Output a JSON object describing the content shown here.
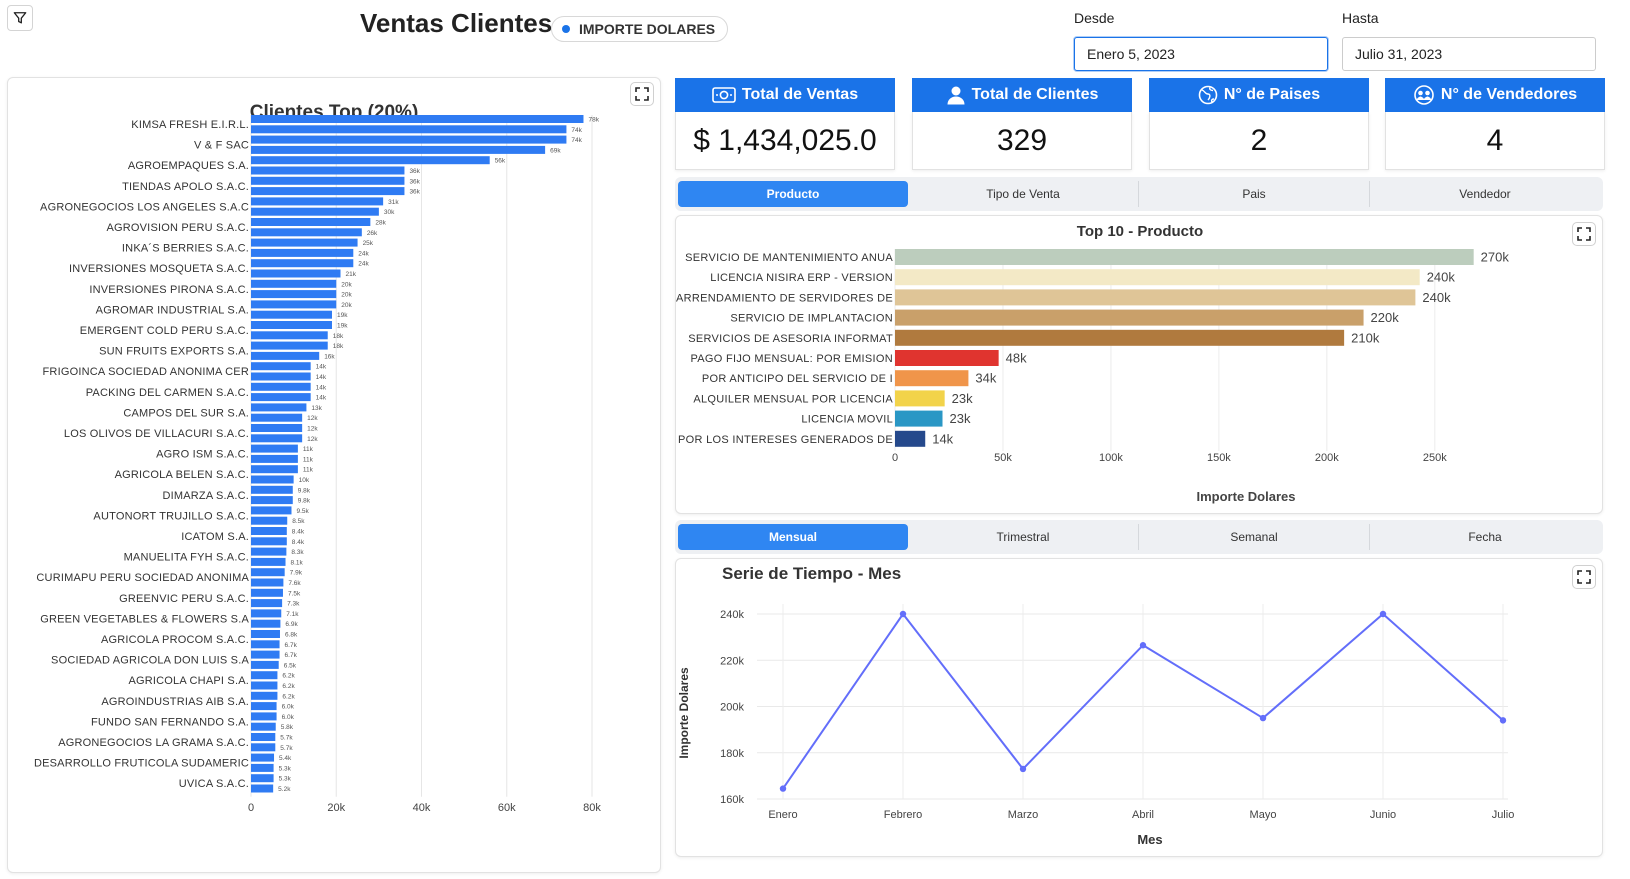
{
  "header": {
    "title": "Ventas Clientes",
    "metric_pill": "IMPORTE DOLARES",
    "desde_label": "Desde",
    "desde_value": "Enero 5, 2023",
    "hasta_label": "Hasta",
    "hasta_value": "Julio 31, 2023"
  },
  "kpis": [
    {
      "label": "Total de Ventas",
      "value": "$ 1,434,025.0",
      "icon": "money-icon"
    },
    {
      "label": "Total de Clientes",
      "value": "329",
      "icon": "user-icon"
    },
    {
      "label": "N° de Paises",
      "value": "2",
      "icon": "globe-icon"
    },
    {
      "label": "N° de Vendedores",
      "value": "4",
      "icon": "team-icon"
    }
  ],
  "tabs_top": [
    {
      "label": "Producto",
      "active": true
    },
    {
      "label": "Tipo de Venta",
      "active": false
    },
    {
      "label": "Pais",
      "active": false
    },
    {
      "label": "Vendedor",
      "active": false
    }
  ],
  "tabs_time": [
    {
      "label": "Mensual",
      "active": true
    },
    {
      "label": "Trimestral",
      "active": false
    },
    {
      "label": "Semanal",
      "active": false
    },
    {
      "label": "Fecha",
      "active": false
    }
  ],
  "colors": {
    "accent": "#1a73e8",
    "bar_blue": "#2f7bf3",
    "line": "#636efa"
  },
  "chart_data": [
    {
      "type": "bar",
      "orientation": "horizontal",
      "title": "Clientes Top (20%)",
      "xticks": [
        "0",
        "20k",
        "40k",
        "60k",
        "80k"
      ],
      "xlim": [
        0,
        80000
      ],
      "grid": true,
      "category_labels": [
        "KIMSA FRESH E.I.R.L.",
        "V & F SAC",
        "AGROEMPAQUES S.A.",
        "TIENDAS APOLO S.A.C.",
        "AGRONEGOCIOS LOS ANGELES S.A.C",
        "AGROVISION PERU S.A.C.",
        "INKA´S BERRIES S.A.C.",
        "INVERSIONES MOSQUETA S.A.C.",
        "INVERSIONES PIRONA S.A.C.",
        "AGROMAR INDUSTRIAL S.A.",
        "EMERGENT COLD PERU S.A.C.",
        "SUN FRUITS EXPORTS S.A.",
        "FRIGOINCA SOCIEDAD ANONIMA CER",
        "PACKING DEL CARMEN S.A.C.",
        "CAMPOS DEL SUR S.A.",
        "LOS OLIVOS DE VILLACURI S.A.C.",
        "AGRO ISM S.A.C.",
        "AGRICOLA BELEN S.A.C.",
        "DIMARZA S.A.C.",
        "AUTONORT TRUJILLO S.A.C.",
        "ICATOM S.A.",
        "MANUELITA FYH S.A.C.",
        "CURIMAPU PERU SOCIEDAD ANONIMA",
        "GREENVIC PERU S.A.C.",
        "GREEN VEGETABLES & FLOWERS S.A",
        "AGRICOLA PROCOM S.A.C.",
        "SOCIEDAD AGRICOLA DON LUIS S.A",
        "AGRICOLA CHAPI S.A.",
        "AGROINDUSTRIAS AIB S.A.",
        "FUNDO SAN FERNANDO S.A.",
        "AGRONEGOCIOS LA GRAMA S.A.C.",
        "DESARROLLO FRUTICOLA SUDAMERIC",
        "UVICA S.A.C."
      ],
      "values": [
        78000,
        74000,
        74000,
        69000,
        56000,
        36000,
        36000,
        36000,
        31000,
        30000,
        28000,
        26000,
        25000,
        24000,
        24000,
        21000,
        20000,
        20000,
        20000,
        19000,
        19000,
        18000,
        18000,
        16000,
        14000,
        14000,
        14000,
        14000,
        13000,
        12000,
        12000,
        12000,
        11000,
        11000,
        11000,
        10000,
        9800,
        9800,
        9500,
        8500,
        8400,
        8400,
        8300,
        8100,
        7900,
        7600,
        7500,
        7300,
        7100,
        6900,
        6800,
        6700,
        6700,
        6500,
        6200,
        6200,
        6200,
        6000,
        6000,
        5800,
        5700,
        5700,
        5400,
        5300,
        5300,
        5200
      ],
      "value_labels": [
        "78k",
        "74k",
        "74k",
        "69k",
        "56k",
        "36k",
        "36k",
        "36k",
        "31k",
        "30k",
        "28k",
        "26k",
        "25k",
        "24k",
        "24k",
        "21k",
        "20k",
        "20k",
        "20k",
        "19k",
        "19k",
        "18k",
        "18k",
        "16k",
        "14k",
        "14k",
        "14k",
        "14k",
        "13k",
        "12k",
        "12k",
        "12k",
        "11k",
        "11k",
        "11k",
        "10k",
        "9.8k",
        "9.8k",
        "9.5k",
        "8.5k",
        "8.4k",
        "8.4k",
        "8.3k",
        "8.1k",
        "7.9k",
        "7.6k",
        "7.5k",
        "7.3k",
        "7.1k",
        "6.9k",
        "6.8k",
        "6.7k",
        "6.7k",
        "6.5k",
        "6.2k",
        "6.2k",
        "6.2k",
        "6.0k",
        "6.0k",
        "5.8k",
        "5.7k",
        "5.7k",
        "5.4k",
        "5.3k",
        "5.3k",
        "5.2k"
      ]
    },
    {
      "type": "bar",
      "orientation": "horizontal",
      "title": "Top 10 - Producto",
      "xlabel": "Importe Dolares",
      "xticks": [
        "0",
        "50k",
        "100k",
        "150k",
        "200k",
        "250k"
      ],
      "xlim": [
        0,
        270000
      ],
      "categories": [
        "SERVICIO DE MANTENIMIENTO ANUA",
        "LICENCIA NISIRA ERP - VERSION",
        "ARRENDAMIENTO DE SERVIDORES DE",
        "SERVICIO DE IMPLANTACION",
        "SERVICIOS DE ASESORIA INFORMAT",
        "PAGO FIJO MENSUAL: POR EMISION",
        "POR ANTICIPO DEL SERVICIO DE I",
        "ALQUILER MENSUAL POR LICENCIA",
        "LICENCIA MOVIL",
        "POR LOS INTERESES GENERADOS DE"
      ],
      "values": [
        268000,
        243000,
        241000,
        217000,
        208000,
        48000,
        34000,
        23000,
        22000,
        14000
      ],
      "value_labels": [
        "270k",
        "240k",
        "240k",
        "220k",
        "210k",
        "48k",
        "34k",
        "23k",
        "23k",
        "14k"
      ],
      "bar_colors": [
        "#bccdbd",
        "#f3e9c6",
        "#dfc597",
        "#c9a06a",
        "#b07a3e",
        "#e0342f",
        "#f0954a",
        "#f2d34a",
        "#2a97c5",
        "#25498c"
      ]
    },
    {
      "type": "line",
      "title": "Serie de Tiempo - Mes",
      "xlabel": "Mes",
      "ylabel": "Importe Dolares",
      "x": [
        "Enero",
        "Febrero",
        "Marzo",
        "Abril",
        "Mayo",
        "Junio",
        "Julio"
      ],
      "y": [
        164500,
        240000,
        173000,
        226500,
        195000,
        240000,
        194000
      ],
      "yticks": [
        "160k",
        "180k",
        "200k",
        "220k",
        "240k"
      ],
      "ylim": [
        160000,
        240000
      ],
      "grid": true
    }
  ]
}
